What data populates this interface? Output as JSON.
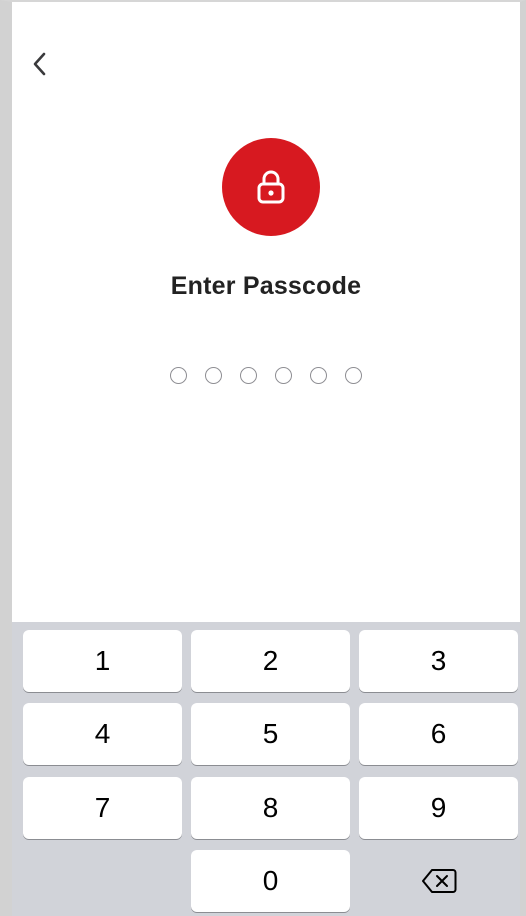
{
  "header": {
    "back_icon": "chevron-left-icon"
  },
  "lock": {
    "icon": "lock-icon",
    "accent_color": "#d71920"
  },
  "title": "Enter Passcode",
  "passcode": {
    "length": 6,
    "entered": 0
  },
  "keypad": {
    "keys": [
      "1",
      "2",
      "3",
      "4",
      "5",
      "6",
      "7",
      "8",
      "9",
      "",
      "0"
    ],
    "delete_icon": "backspace-icon"
  }
}
